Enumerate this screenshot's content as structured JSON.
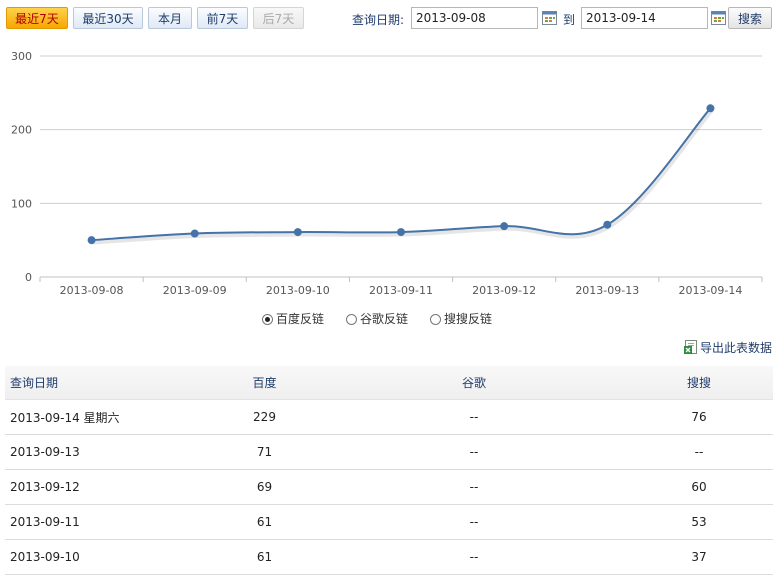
{
  "range_buttons": [
    {
      "label": "最近7天",
      "state": "active"
    },
    {
      "label": "最近30天",
      "state": "normal"
    },
    {
      "label": "本月",
      "state": "normal"
    },
    {
      "label": "前7天",
      "state": "normal"
    },
    {
      "label": "后7天",
      "state": "disabled"
    }
  ],
  "query": {
    "label": "查询日期:",
    "start_date": "2013-09-08",
    "to_label": "到",
    "end_date": "2013-09-14",
    "search_label": "搜索"
  },
  "chart_data": {
    "type": "line",
    "categories": [
      "2013-09-08",
      "2013-09-09",
      "2013-09-10",
      "2013-09-11",
      "2013-09-12",
      "2013-09-13",
      "2013-09-14"
    ],
    "series": [
      {
        "name": "百度反链",
        "values": [
          50,
          59,
          61,
          61,
          69,
          71,
          229
        ],
        "color": "#4572a7"
      }
    ],
    "yticks": [
      0,
      100,
      200,
      300
    ],
    "ylim": [
      0,
      300
    ],
    "grid": true
  },
  "legend": [
    {
      "label": "百度反链",
      "selected": true
    },
    {
      "label": "谷歌反链",
      "selected": false
    },
    {
      "label": "搜搜反链",
      "selected": false
    }
  ],
  "export_label": "导出此表数据",
  "table": {
    "headers": [
      "查询日期",
      "百度",
      "谷歌",
      "搜搜"
    ],
    "rows": [
      [
        "2013-09-14 星期六",
        "229",
        "--",
        "76"
      ],
      [
        "2013-09-13",
        "71",
        "--",
        "--"
      ],
      [
        "2013-09-12",
        "69",
        "--",
        "60"
      ],
      [
        "2013-09-11",
        "61",
        "--",
        "53"
      ],
      [
        "2013-09-10",
        "61",
        "--",
        "37"
      ]
    ]
  }
}
